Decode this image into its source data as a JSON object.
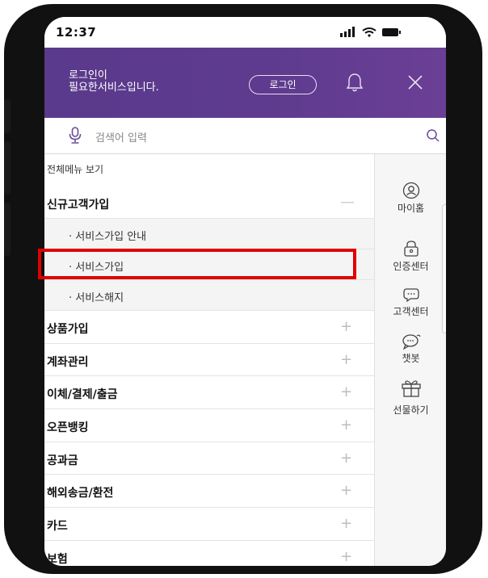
{
  "status_bar": {
    "time": "12:37"
  },
  "header": {
    "login_message": [
      "로그인이",
      "필요한서비스입니다."
    ],
    "login_button": "로그인",
    "background_color": "#5e3b8e"
  },
  "search": {
    "placeholder": "검색어 입력"
  },
  "menu": {
    "all_menu_label": "전체메뉴 보기",
    "expanded_category": "신규고객가입",
    "expanded_symbol": "—",
    "sub_items": [
      "· 서비스가입 안내",
      "· 서비스가입",
      "· 서비스해지"
    ],
    "highlighted_item": "· 서비스가입",
    "highlight_color": "#e00000",
    "categories": [
      "상품가입",
      "계좌관리",
      "이체/결제/출금",
      "오픈뱅킹",
      "공과금",
      "해외송금/환전",
      "카드",
      "보험"
    ],
    "collapsed_symbol": "+"
  },
  "side_menu": [
    {
      "icon": "user-icon",
      "label": "마이홈"
    },
    {
      "icon": "lock-icon",
      "label": "인증센터"
    },
    {
      "icon": "chat-bubble-icon",
      "label": "고객센터"
    },
    {
      "icon": "chatbot-icon",
      "label": "챗봇"
    },
    {
      "icon": "gift-icon",
      "label": "선물하기"
    }
  ]
}
